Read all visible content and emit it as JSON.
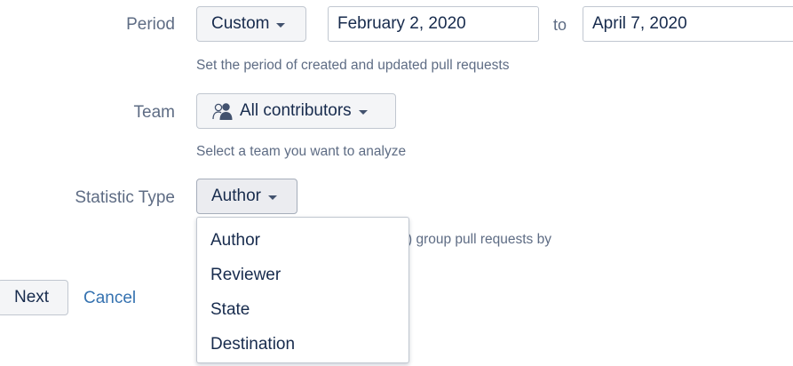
{
  "period": {
    "label": "Period",
    "select_value": "Custom",
    "start_date": "February 2, 2020",
    "to_label": "to",
    "end_date": "April 7, 2020",
    "help": "Set the period of created and updated pull requests"
  },
  "team": {
    "label": "Team",
    "icon": "team-icon",
    "select_value": "All contributors",
    "help": "Select a team you want to analyze"
  },
  "statistic_type": {
    "label": "Statistic Type",
    "select_value": "Author",
    "help_partial": ") group pull requests by",
    "options": [
      "Author",
      "Reviewer",
      "State",
      "Destination"
    ]
  },
  "actions": {
    "next_label": "Next",
    "cancel_label": "Cancel"
  },
  "colors": {
    "link": "#3572b0",
    "muted_text": "#5e6c84",
    "border": "#c1c7d0",
    "button_bg": "#f4f5f7"
  }
}
